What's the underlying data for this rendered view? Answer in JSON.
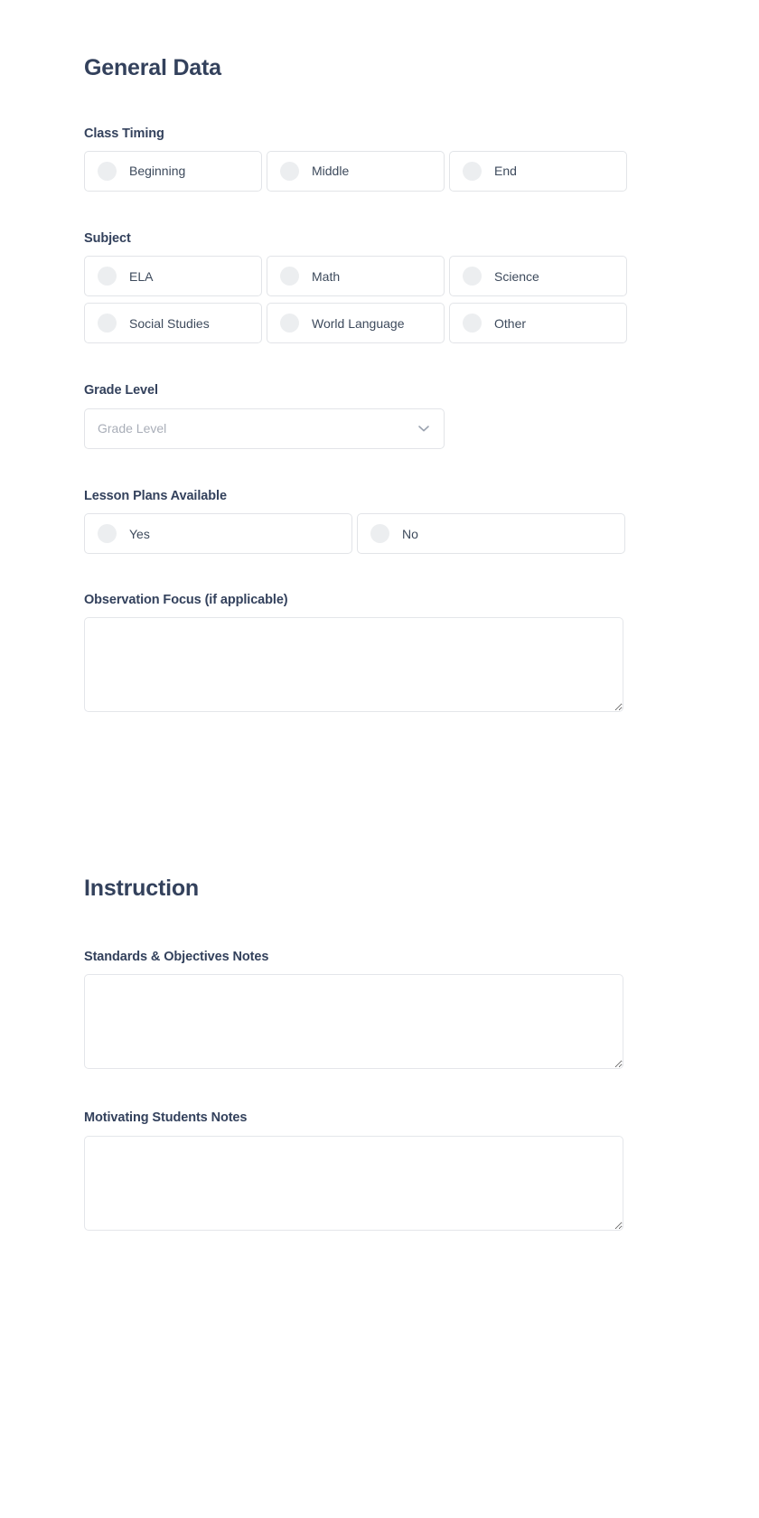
{
  "sections": [
    {
      "id": "general-data",
      "title": "General Data",
      "fields": [
        {
          "key": "class_timing",
          "label": "Class Timing",
          "type": "radio-cards",
          "columns": 3,
          "options": [
            "Beginning",
            "Middle",
            "End"
          ]
        },
        {
          "key": "subject",
          "label": "Subject",
          "type": "radio-cards",
          "columns": 3,
          "options": [
            "ELA",
            "Math",
            "Science",
            "Social Studies",
            "World Language",
            "Other"
          ]
        },
        {
          "key": "grade_level",
          "label": "Grade Level",
          "type": "select",
          "placeholder": "Grade Level",
          "value": "",
          "icon": "chevron-down-icon"
        },
        {
          "key": "lesson_plans_available",
          "label": "Lesson Plans Available",
          "type": "radio-cards",
          "columns": 2,
          "options": [
            "Yes",
            "No"
          ]
        },
        {
          "key": "observation_focus",
          "label": "Observation Focus (if applicable)",
          "type": "textarea",
          "value": "",
          "placeholder": ""
        }
      ]
    },
    {
      "id": "instruction",
      "title": "Instruction",
      "fields": [
        {
          "key": "standards_objectives_notes",
          "label": "Standards & Objectives Notes",
          "type": "textarea",
          "value": "",
          "placeholder": ""
        },
        {
          "key": "motivating_students_notes",
          "label": "Motivating Students Notes",
          "type": "textarea",
          "value": "",
          "placeholder": ""
        }
      ]
    }
  ],
  "colors": {
    "heading": "#33415c",
    "label": "#33415c",
    "option_text": "#3d4a5c",
    "border": "#e2e4e8",
    "radio_fill": "#eceef0",
    "placeholder": "#a9aeb8",
    "background": "#ffffff"
  }
}
